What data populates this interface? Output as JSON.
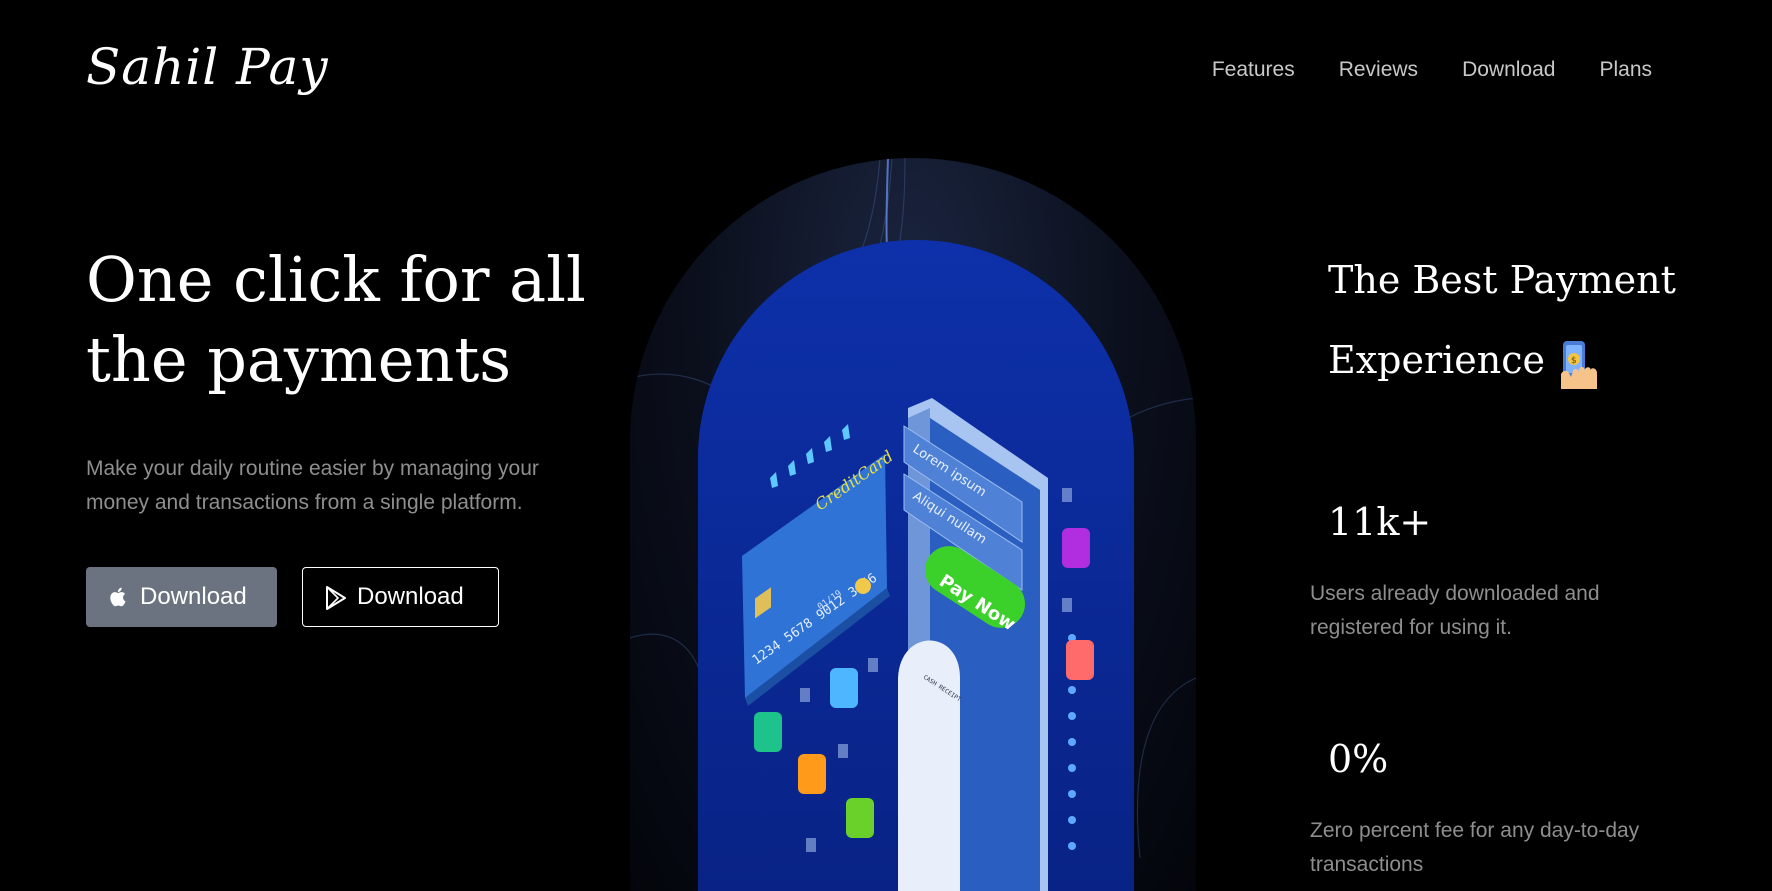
{
  "brand": {
    "name": "Sahil Pay"
  },
  "nav": {
    "items": [
      {
        "label": "Features"
      },
      {
        "label": "Reviews"
      },
      {
        "label": "Download"
      },
      {
        "label": "Plans"
      }
    ]
  },
  "hero": {
    "title": "One click for all the payments",
    "description": "Make your daily routine easier by managing your money and transactions from a single platform.",
    "buttons": {
      "apple": {
        "label": "Download",
        "icon": "apple-icon"
      },
      "play": {
        "label": "Download",
        "icon": "google-play-icon"
      }
    },
    "illustration": {
      "card_brand": "CreditCard",
      "card_number": "1234 5678 9012 3456",
      "card_expiry": "01/19",
      "phone_row_1": "Lorem ipsum",
      "phone_row_2": "Aliqui nullam",
      "pay_button": "Pay Now",
      "receipt_title": "CASH RECEIPT"
    }
  },
  "side": {
    "title": "The Best Payment Experience",
    "title_icon": "phone-payment-icon",
    "stats": [
      {
        "value": "11k+",
        "description": "Users already downloaded and registered for using it."
      },
      {
        "value": "0%",
        "description": "Zero percent fee for any day-to-day transactions"
      }
    ]
  },
  "colors": {
    "accent_button": "#6b7380",
    "muted_text": "#8e8e8e",
    "pay_green": "#3bd12a"
  }
}
